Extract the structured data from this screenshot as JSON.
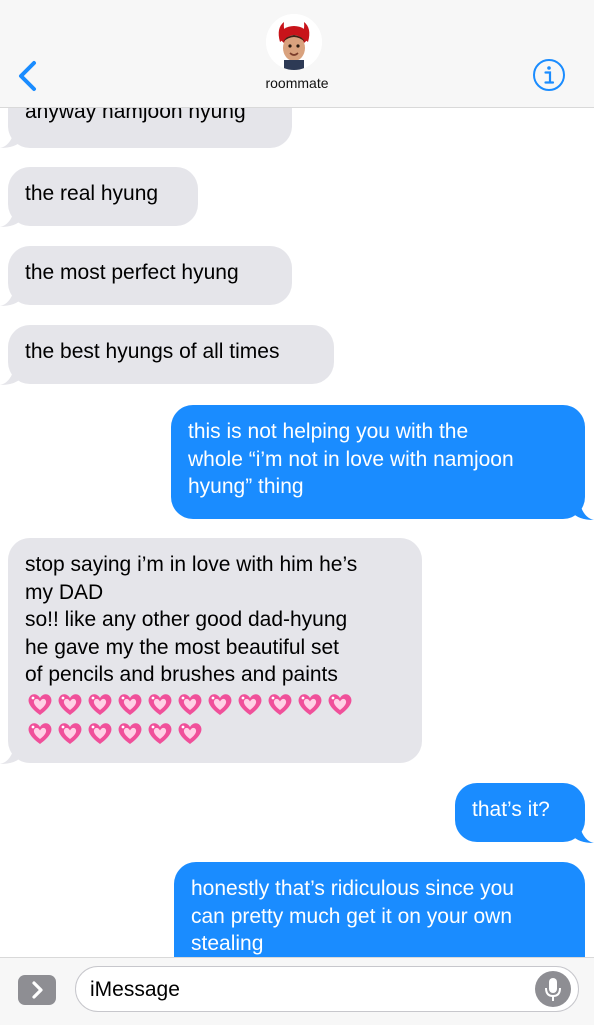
{
  "header": {
    "contact_name": "roommate",
    "back_icon": "chevron-left-icon",
    "info_icon": "info-icon",
    "avatar": "devil-horns-avatar",
    "accent_color": "#1a8cff"
  },
  "messages": [
    {
      "direction": "received",
      "lines": [
        "anyway namjoon hyung"
      ]
    },
    {
      "direction": "received",
      "lines": [
        "the real hyung"
      ]
    },
    {
      "direction": "received",
      "lines": [
        "the most perfect hyung"
      ]
    },
    {
      "direction": "received",
      "lines": [
        "the best hyungs of all times"
      ]
    },
    {
      "direction": "sent",
      "lines": [
        "this is not helping you with the",
        "whole “i’m not in love with namjoon",
        "hyung” thing"
      ]
    },
    {
      "direction": "received",
      "lines": [
        "stop saying i’m in love with him he’s",
        "my DAD",
        "so!! like any other good dad-hyung",
        "he gave my the most beautiful set",
        "of pencils and brushes and paints"
      ],
      "emoji": "💗",
      "emoji_rows": [
        11,
        6
      ]
    },
    {
      "direction": "sent",
      "lines": [
        "that’s it?"
      ]
    },
    {
      "direction": "sent",
      "lines": [
        "honestly that’s ridiculous since you",
        "can pretty much get it on your own",
        "stealing"
      ]
    }
  ],
  "composer": {
    "placeholder": "iMessage",
    "expand_icon": "chevron-right-icon",
    "mic_icon": "microphone-icon"
  },
  "colors": {
    "received_bubble": "#e5e5ea",
    "sent_bubble": "#1a8cff",
    "heart": "#f0509a"
  }
}
